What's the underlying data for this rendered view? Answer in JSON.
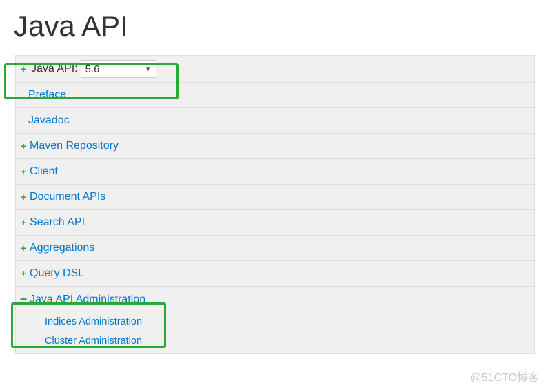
{
  "page": {
    "title": "Java API"
  },
  "version": {
    "label": "Java API:",
    "selected": "5.6"
  },
  "nav": {
    "preface": "Preface",
    "javadoc": "Javadoc",
    "maven": "Maven Repository",
    "client": "Client",
    "docapis": "Document APIs",
    "search": "Search API",
    "aggs": "Aggregations",
    "querydsl": "Query DSL",
    "admin": "Java API Administration",
    "admin_sub": {
      "indices": "Indices Administration",
      "cluster": "Cluster Administration"
    }
  },
  "watermark": "@51CTO博客"
}
